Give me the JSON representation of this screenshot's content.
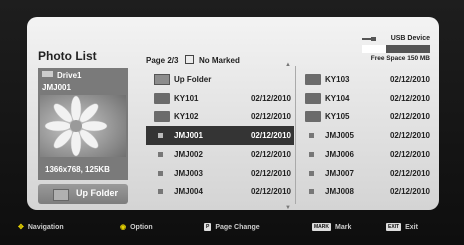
{
  "header": {
    "title": "Photo List",
    "page_info": "Page 2/3",
    "mark_status": "No Marked",
    "device": "USB Device",
    "free_space": "Free Space 150 MB",
    "free_space_ratio": 0.35
  },
  "preview": {
    "drive": "Drive1",
    "name": "JMJ001",
    "resolution": "1366x768, 125KB",
    "up_folder_label": "Up Folder"
  },
  "grid": {
    "left": [
      {
        "name": "Up Folder",
        "date": "",
        "type": "up"
      },
      {
        "name": "KY101",
        "date": "02/12/2010",
        "type": "folder"
      },
      {
        "name": "KY102",
        "date": "02/12/2010",
        "type": "folder"
      },
      {
        "name": "JMJ001",
        "date": "02/12/2010",
        "type": "file",
        "selected": true
      },
      {
        "name": "JMJ002",
        "date": "02/12/2010",
        "type": "file"
      },
      {
        "name": "JMJ003",
        "date": "02/12/2010",
        "type": "file"
      },
      {
        "name": "JMJ004",
        "date": "02/12/2010",
        "type": "file"
      }
    ],
    "right": [
      {
        "name": "KY103",
        "date": "02/12/2010",
        "type": "folder"
      },
      {
        "name": "KY104",
        "date": "02/12/2010",
        "type": "folder"
      },
      {
        "name": "KY105",
        "date": "02/12/2010",
        "type": "folder"
      },
      {
        "name": "JMJ005",
        "date": "02/12/2010",
        "type": "file"
      },
      {
        "name": "JMJ006",
        "date": "02/12/2010",
        "type": "file"
      },
      {
        "name": "JMJ007",
        "date": "02/12/2010",
        "type": "file"
      },
      {
        "name": "JMJ008",
        "date": "02/12/2010",
        "type": "file"
      }
    ]
  },
  "footer": {
    "navigation": "Navigation",
    "option": "Option",
    "page_change_key": "P",
    "page_change": "Page Change",
    "mark_key": "MARK",
    "mark": "Mark",
    "exit_key": "EXIT",
    "exit": "Exit"
  }
}
